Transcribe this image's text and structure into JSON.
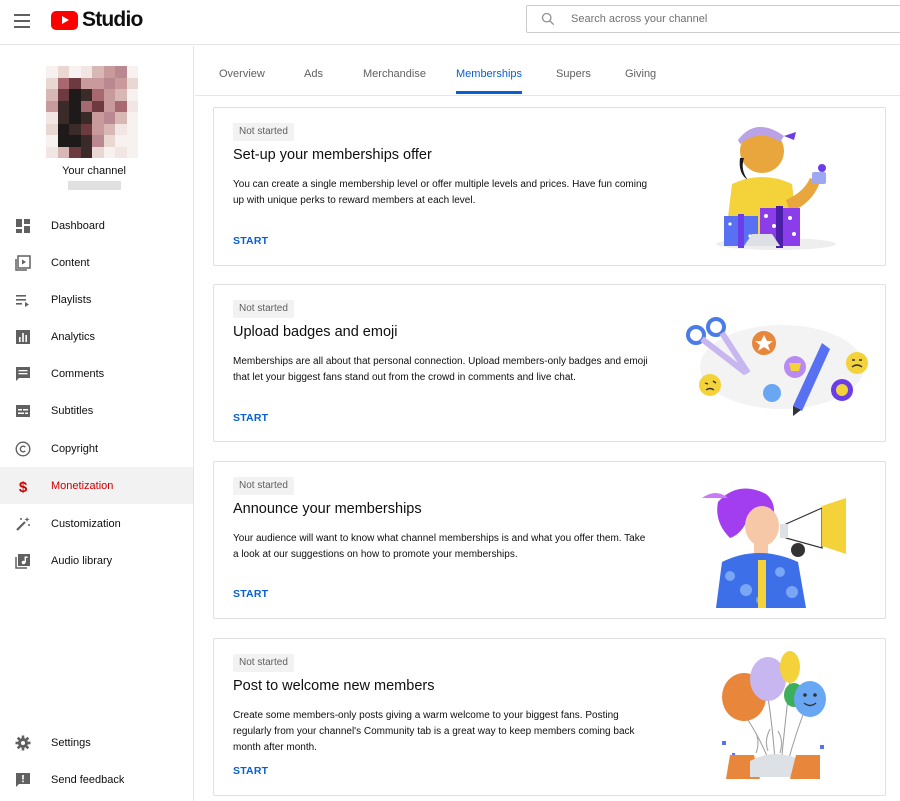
{
  "header": {
    "logo_text": "Studio",
    "search_placeholder": "Search across your channel"
  },
  "sidebar": {
    "channel_name": "Your channel",
    "items": [
      {
        "label": "Dashboard",
        "icon": "dashboard-icon"
      },
      {
        "label": "Content",
        "icon": "content-icon"
      },
      {
        "label": "Playlists",
        "icon": "playlists-icon"
      },
      {
        "label": "Analytics",
        "icon": "analytics-icon"
      },
      {
        "label": "Comments",
        "icon": "comments-icon"
      },
      {
        "label": "Subtitles",
        "icon": "subtitles-icon"
      },
      {
        "label": "Copyright",
        "icon": "copyright-icon"
      },
      {
        "label": "Monetization",
        "icon": "dollar-icon",
        "active": true
      },
      {
        "label": "Customization",
        "icon": "magic-wand-icon"
      },
      {
        "label": "Audio library",
        "icon": "audio-library-icon"
      }
    ],
    "bottom_items": [
      {
        "label": "Settings",
        "icon": "gear-icon"
      },
      {
        "label": "Send feedback",
        "icon": "feedback-icon"
      }
    ]
  },
  "tabs": [
    {
      "label": "Overview"
    },
    {
      "label": "Ads"
    },
    {
      "label": "Merchandise"
    },
    {
      "label": "Memberships",
      "active": true
    },
    {
      "label": "Supers"
    },
    {
      "label": "Giving"
    }
  ],
  "cards": [
    {
      "status": "Not started",
      "title": "Set-up your memberships offer",
      "description": "You can create a single membership level or offer multiple levels and prices. Have fun coming up with unique perks to reward members at each level.",
      "action": "START",
      "illustration": "gift-person-illustration"
    },
    {
      "status": "Not started",
      "title": "Upload badges and emoji",
      "description": "Memberships are all about that personal connection. Upload members-only badges and emoji that let your biggest fans stand out from the crowd in comments and live chat.",
      "action": "START",
      "illustration": "badges-emoji-illustration"
    },
    {
      "status": "Not started",
      "title": "Announce your memberships",
      "description": "Your audience will want to know what channel memberships is and what you offer them. Take a look at our suggestions on how to promote your memberships.",
      "action": "START",
      "illustration": "megaphone-illustration"
    },
    {
      "status": "Not started",
      "title": "Post to welcome new members",
      "description": "Create some members-only posts giving a warm welcome to your biggest fans. Posting regularly from your channel's Community tab is a great way to keep members coming back month after month.",
      "action": "START",
      "illustration": "balloons-illustration"
    }
  ],
  "colors": {
    "brand_red": "#ff0000",
    "active_red": "#cc0000",
    "link_blue": "#065fd4"
  }
}
